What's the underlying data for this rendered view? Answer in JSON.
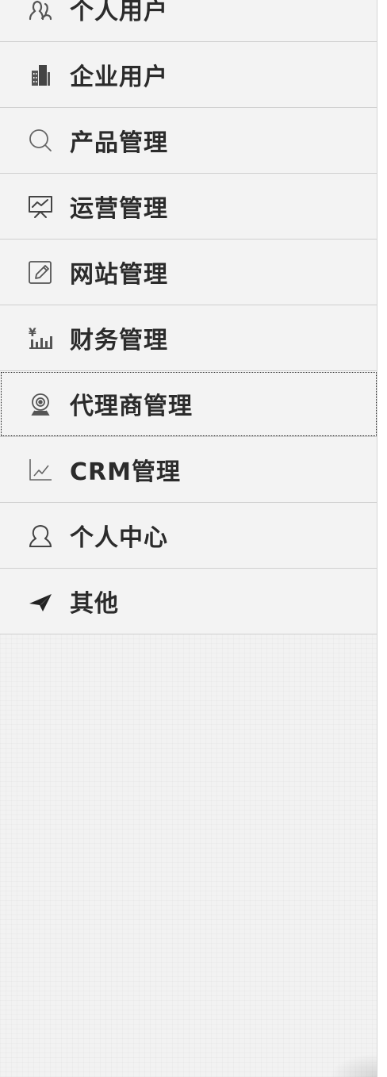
{
  "sidebar": {
    "items": [
      {
        "label": "个人用户",
        "icon": "users-icon"
      },
      {
        "label": "企业用户",
        "icon": "building-icon"
      },
      {
        "label": "产品管理",
        "icon": "search-icon"
      },
      {
        "label": "运营管理",
        "icon": "presentation-icon"
      },
      {
        "label": "网站管理",
        "icon": "edit-icon"
      },
      {
        "label": "财务管理",
        "icon": "finance-chart-icon"
      },
      {
        "label": "代理商管理",
        "icon": "webcam-icon"
      },
      {
        "label": "CRM管理",
        "icon": "line-chart-icon"
      },
      {
        "label": "个人中心",
        "icon": "user-icon"
      },
      {
        "label": "其他",
        "icon": "paper-plane-icon"
      }
    ],
    "focused_item": "代理商管理"
  },
  "colors": {
    "text": "#2b2b2b",
    "icon": "#555555",
    "background": "#f2f2f2",
    "divider": "#cfcfcf"
  }
}
